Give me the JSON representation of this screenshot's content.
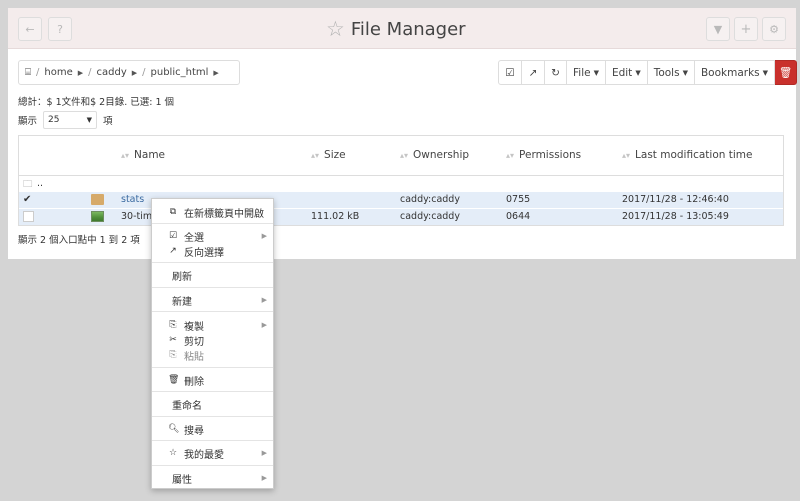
{
  "app": {
    "title": "File Manager"
  },
  "titlebar": {
    "back_icon": "arrow-left-icon",
    "help_icon": "question-circle-icon",
    "filter_icon": "filter-icon",
    "add_icon": "plus-icon",
    "settings_icon": "gear-icon"
  },
  "breadcrumb": {
    "root_icon": "drive-icon",
    "items": [
      "home",
      "caddy",
      "public_html"
    ]
  },
  "toolbar": {
    "file_label": "File",
    "edit_label": "Edit",
    "tools_label": "Tools",
    "bookmarks_label": "Bookmarks"
  },
  "summary": "總計：$ 1文件和$ 2目錄. 已選: 1 個",
  "pagesize": {
    "prefix": "顯示",
    "value": "25",
    "suffix": "項"
  },
  "table": {
    "headers": {
      "name": "Name",
      "size": "Size",
      "ownership": "Ownership",
      "permissions": "Permissions",
      "modified": "Last modification time"
    },
    "parent_label": "..",
    "rows": [
      {
        "name": "stats",
        "size": "",
        "ownership": "caddy:caddy",
        "permissions": "0755",
        "modified": "2017/11/28 - 12:46:40"
      },
      {
        "name": "30-timi",
        "size": "111.02 kB",
        "ownership": "caddy:caddy",
        "permissions": "0644",
        "modified": "2017/11/28 - 13:05:49"
      }
    ]
  },
  "footer": "顯示 2 個入口點中 1 到 2 項",
  "context_menu": {
    "open_new_tab": "在新標籤頁中開啟",
    "select_all": "全選",
    "invert_selection": "反向選擇",
    "refresh": "刷新",
    "new": "新建",
    "copy": "複製",
    "cut": "剪切",
    "paste": "粘貼",
    "delete": "刪除",
    "rename": "重命名",
    "search": "搜尋",
    "favorites": "我的最愛",
    "properties": "屬性"
  },
  "colors": {
    "accent_danger": "#c9302c",
    "selected_row": "#e4edf8",
    "titlebar": "#f4ecec"
  }
}
